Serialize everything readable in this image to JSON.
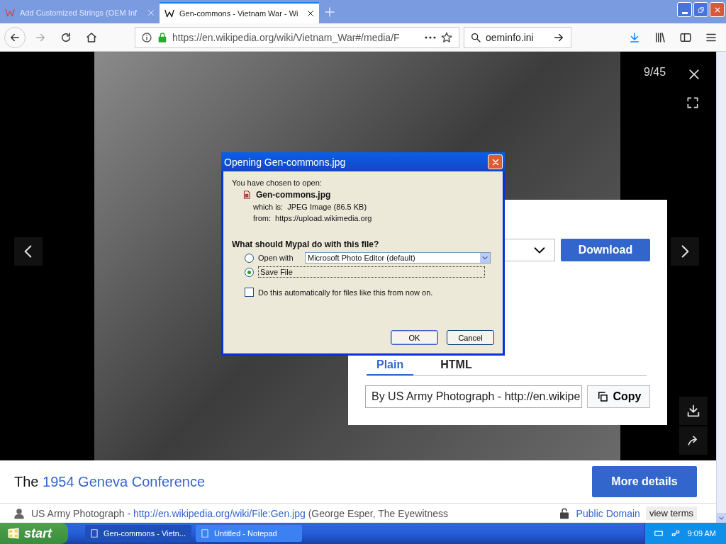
{
  "browser": {
    "tabs": [
      {
        "title": "Add Customized Strings (OEM Inf",
        "selected": false
      },
      {
        "title": "Gen-commons - Vietnam War - Wi",
        "selected": true
      }
    ],
    "url": "https://en.wikipedia.org/wiki/Vietnam_War#/media/F",
    "search": {
      "value": "oeminfo.ini"
    }
  },
  "viewer": {
    "counter": "9/45"
  },
  "download_panel": {
    "button": "Download",
    "tabs": [
      {
        "label": "Plain",
        "selected": true
      },
      {
        "label": "HTML",
        "selected": false
      }
    ],
    "attribution": "By US Army Photograph - http://en.wikipe",
    "copy": "Copy"
  },
  "dialog": {
    "title": "Opening Gen-commons.jpg",
    "intro": "You have chosen to open:",
    "file": "Gen-commons.jpg",
    "which_label": "which is:",
    "which": "JPEG Image (86.5 KB)",
    "from_label": "from:",
    "from": "https://upload.wikimedia.org",
    "question": "What should Mypal do with this file?",
    "options": [
      {
        "label": "Open with",
        "selected": false,
        "app": "Microsoft Photo Editor (default)"
      },
      {
        "label": "Save File",
        "selected": true
      }
    ],
    "auto": {
      "label": "Do this automatically for files like this from now on.",
      "checked": false
    },
    "buttons": [
      "OK",
      "Cancel"
    ]
  },
  "caption": {
    "prefix": "The",
    "title": "1954 Geneva Conference",
    "more": "More details",
    "author": "US Army Photograph - ",
    "link": "http://en.wikipedia.org/wiki/File:Gen.jpg",
    "rest": " (George Esper, The Eyewitness",
    "license": "Public Domain",
    "terms": "view terms"
  },
  "taskbar": {
    "start": "start",
    "items": [
      {
        "label": "Gen-commons - Vietn...",
        "selected": true
      },
      {
        "label": "Untitled - Notepad",
        "selected": false
      }
    ],
    "clock": "9:09 AM"
  }
}
